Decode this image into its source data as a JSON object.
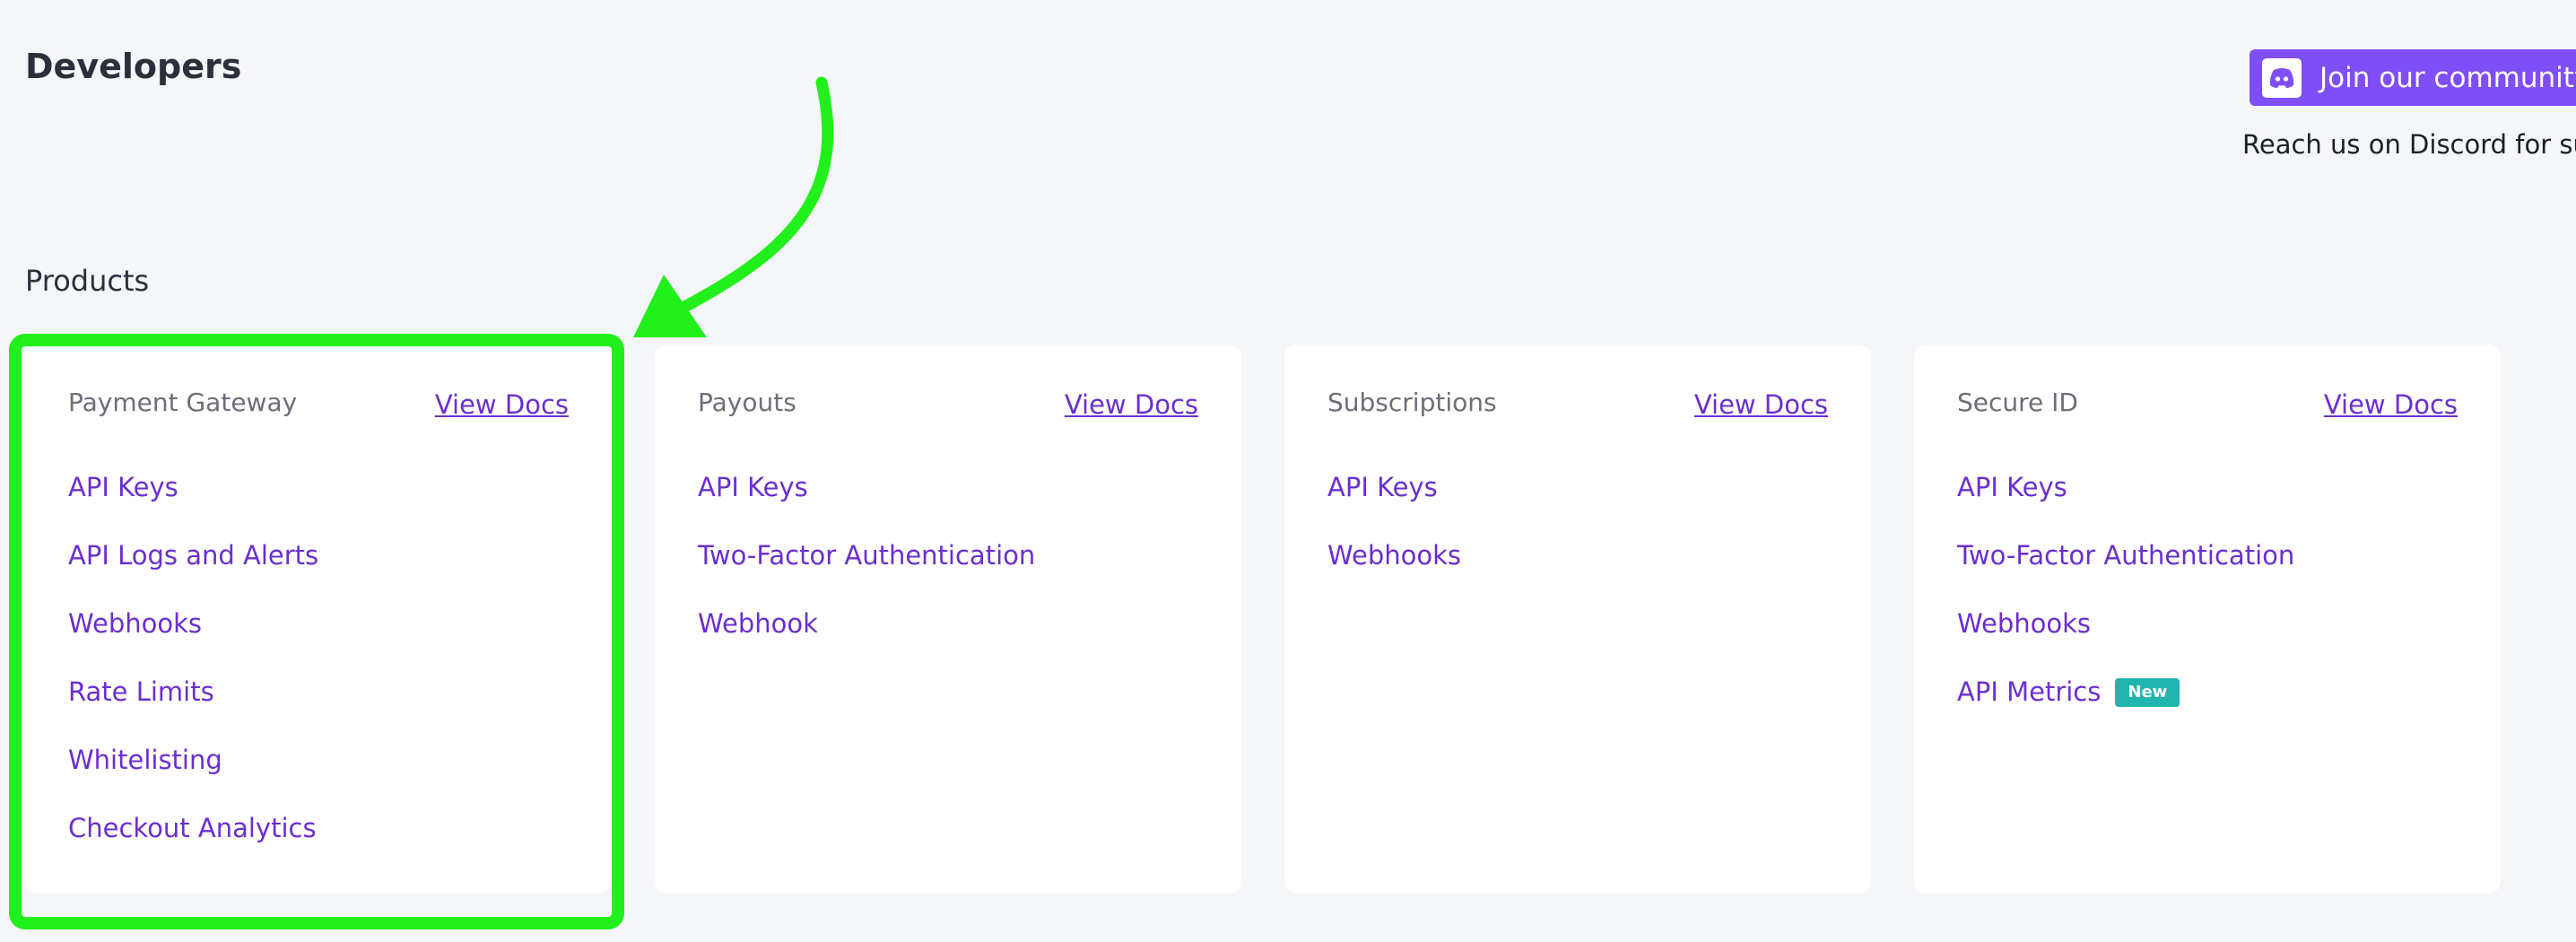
{
  "page": {
    "title": "Developers"
  },
  "community": {
    "button_label": "Join our community",
    "icon": "discord-icon",
    "note": "Reach us on Discord for supp"
  },
  "products": {
    "section_title": "Products",
    "cards": [
      {
        "name": "Payment Gateway",
        "docs_label": "View Docs",
        "links": [
          "API Keys",
          "API Logs and Alerts",
          "Webhooks",
          "Rate Limits",
          "Whitelisting",
          "Checkout Analytics"
        ]
      },
      {
        "name": "Payouts",
        "docs_label": "View Docs",
        "links": [
          "API Keys",
          "Two-Factor Authentication",
          "Webhook"
        ]
      },
      {
        "name": "Subscriptions",
        "docs_label": "View Docs",
        "links": [
          "API Keys",
          "Webhooks"
        ]
      },
      {
        "name": "Secure ID",
        "docs_label": "View Docs",
        "links": [
          "API Keys",
          "Two-Factor Authentication",
          "Webhooks",
          "API Metrics"
        ],
        "badge": "New"
      }
    ]
  },
  "annotation": {
    "highlight_color": "#22f01c",
    "arrow_color": "#22f01c"
  },
  "colors": {
    "accent": "#7f4ef6",
    "link": "#6a2fd0",
    "badge": "#1fb5ae",
    "background": "#f5f6f9"
  }
}
